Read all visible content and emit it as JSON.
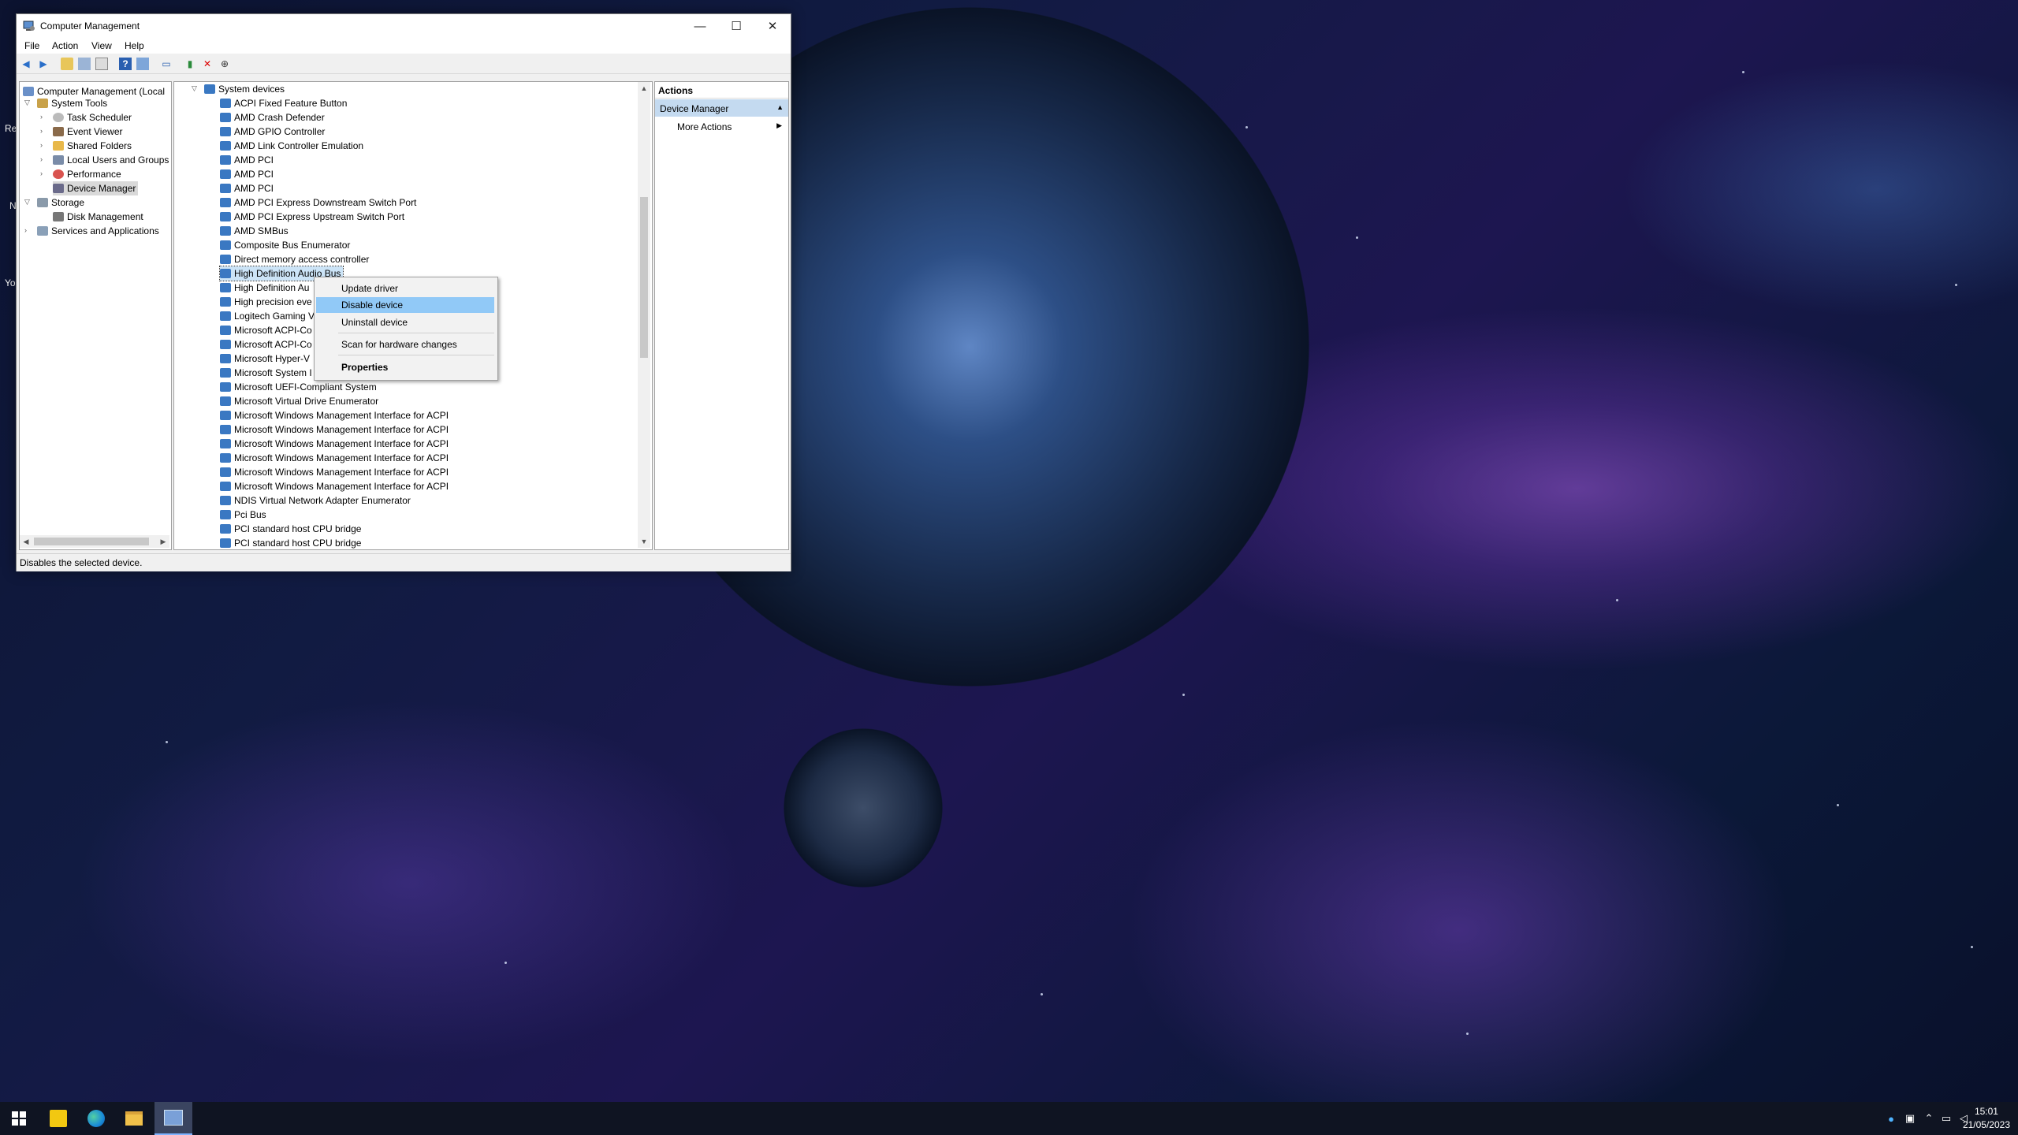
{
  "window": {
    "title": "Computer Management",
    "minimize_label": "—",
    "maximize_label": "☐",
    "close_label": "✕"
  },
  "menu": {
    "file": "File",
    "action": "Action",
    "view": "View",
    "help": "Help"
  },
  "left_tree": {
    "root": "Computer Management (Local",
    "system_tools": "System Tools",
    "task_scheduler": "Task Scheduler",
    "event_viewer": "Event Viewer",
    "shared_folders": "Shared Folders",
    "local_users": "Local Users and Groups",
    "performance": "Performance",
    "device_manager": "Device Manager",
    "storage": "Storage",
    "disk_management": "Disk Management",
    "services": "Services and Applications"
  },
  "device_list": {
    "category": "System devices",
    "items": [
      "ACPI Fixed Feature Button",
      "AMD Crash Defender",
      "AMD GPIO Controller",
      "AMD Link Controller Emulation",
      "AMD PCI",
      "AMD PCI",
      "AMD PCI",
      "AMD PCI Express Downstream Switch Port",
      "AMD PCI Express Upstream Switch Port",
      "AMD SMBus",
      "Composite Bus Enumerator",
      "Direct memory access controller",
      "High Definition Audio Bus",
      "High Definition Au",
      "High precision eve",
      "Logitech Gaming V",
      "Microsoft ACPI-Co",
      "Microsoft ACPI-Co",
      "Microsoft Hyper-V",
      "Microsoft System I",
      "Microsoft UEFI-Compliant System",
      "Microsoft Virtual Drive Enumerator",
      "Microsoft Windows Management Interface for ACPI",
      "Microsoft Windows Management Interface for ACPI",
      "Microsoft Windows Management Interface for ACPI",
      "Microsoft Windows Management Interface for ACPI",
      "Microsoft Windows Management Interface for ACPI",
      "Microsoft Windows Management Interface for ACPI",
      "NDIS Virtual Network Adapter Enumerator",
      "Pci Bus",
      "PCI standard host CPU bridge",
      "PCI standard host CPU bridge"
    ]
  },
  "actions": {
    "header": "Actions",
    "section": "Device Manager",
    "more": "More Actions"
  },
  "context_menu": {
    "update": "Update driver",
    "disable": "Disable device",
    "uninstall": "Uninstall device",
    "scan": "Scan for hardware changes",
    "properties": "Properties"
  },
  "status": {
    "text": "Disables the selected device."
  },
  "taskbar": {
    "time": "15:01",
    "date": "21/05/2023"
  },
  "desktop": {
    "icon_a": "Re",
    "icon_b": "N",
    "icon_c": "Yo"
  },
  "colors": {
    "selection": "#91c9f7",
    "folder": "#e8b84a",
    "device": "#3a78c2"
  }
}
